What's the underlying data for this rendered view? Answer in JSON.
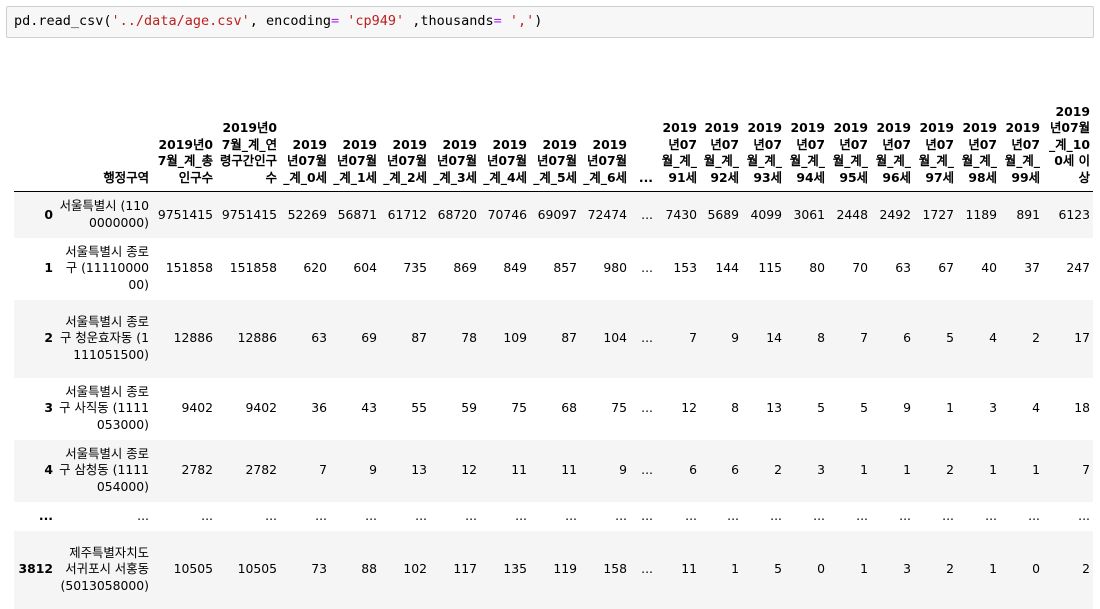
{
  "code": {
    "prefix": "pd.read_csv(",
    "path": "'../data/age.csv'",
    "mid1": ", encoding",
    "eq": "=",
    "enc": " 'cp949'",
    "mid2": " ,thousands",
    "eq2": "=",
    "sep": " ','",
    "suffix": ")"
  },
  "table": {
    "index_header": "",
    "columns": [
      "행정구역",
      "2019년07월_계_총인구수",
      "2019년07월_계_연령구간인구수",
      "2019년07월_계_0세",
      "2019년07월_계_1세",
      "2019년07월_계_2세",
      "2019년07월_계_3세",
      "2019년07월_계_4세",
      "2019년07월_계_5세",
      "2019년07월_계_6세",
      "...",
      "2019년07월_계_91세",
      "2019년07월_계_92세",
      "2019년07월_계_93세",
      "2019년07월_계_94세",
      "2019년07월_계_95세",
      "2019년07월_계_96세",
      "2019년07월_계_97세",
      "2019년07월_계_98세",
      "2019년07월_계_99세",
      "2019년07월_계_100세 이상"
    ],
    "rows": [
      {
        "index": "0",
        "cells": [
          "서울특별시 (1100000000)",
          "9751415",
          "9751415",
          "52269",
          "56871",
          "61712",
          "68720",
          "70746",
          "69097",
          "72474",
          "...",
          "7430",
          "5689",
          "4099",
          "3061",
          "2448",
          "2492",
          "1727",
          "1189",
          "891",
          "6123"
        ]
      },
      {
        "index": "1",
        "cells": [
          "서울특별시 종로구 (1111000000)",
          "151858",
          "151858",
          "620",
          "604",
          "735",
          "869",
          "849",
          "857",
          "980",
          "...",
          "153",
          "144",
          "115",
          "80",
          "70",
          "63",
          "67",
          "40",
          "37",
          "247"
        ]
      },
      {
        "index": "2",
        "cells": [
          "서울특별시 종로구 청운효자동 (1111051500)",
          "12886",
          "12886",
          "63",
          "69",
          "87",
          "78",
          "109",
          "87",
          "104",
          "...",
          "7",
          "9",
          "14",
          "8",
          "7",
          "6",
          "5",
          "4",
          "2",
          "17"
        ]
      },
      {
        "index": "3",
        "cells": [
          "서울특별시 종로구 사직동 (1111053000)",
          "9402",
          "9402",
          "36",
          "43",
          "55",
          "59",
          "75",
          "68",
          "75",
          "...",
          "12",
          "8",
          "13",
          "5",
          "5",
          "9",
          "1",
          "3",
          "4",
          "18"
        ]
      },
      {
        "index": "4",
        "cells": [
          "서울특별시 종로구 삼청동 (1111054000)",
          "2782",
          "2782",
          "7",
          "9",
          "13",
          "12",
          "11",
          "11",
          "9",
          "...",
          "6",
          "6",
          "2",
          "3",
          "1",
          "1",
          "2",
          "1",
          "1",
          "7"
        ]
      },
      {
        "index": "...",
        "cells": [
          "...",
          "...",
          "...",
          "...",
          "...",
          "...",
          "...",
          "...",
          "...",
          "...",
          "...",
          "...",
          "...",
          "...",
          "...",
          "...",
          "...",
          "...",
          "...",
          "...",
          "..."
        ]
      },
      {
        "index": "3812",
        "cells": [
          "제주특별자치도 서귀포시 서홍동 (5013058000)",
          "10505",
          "10505",
          "73",
          "88",
          "102",
          "117",
          "135",
          "119",
          "158",
          "...",
          "11",
          "1",
          "5",
          "0",
          "1",
          "3",
          "2",
          "1",
          "0",
          "2"
        ]
      }
    ]
  }
}
